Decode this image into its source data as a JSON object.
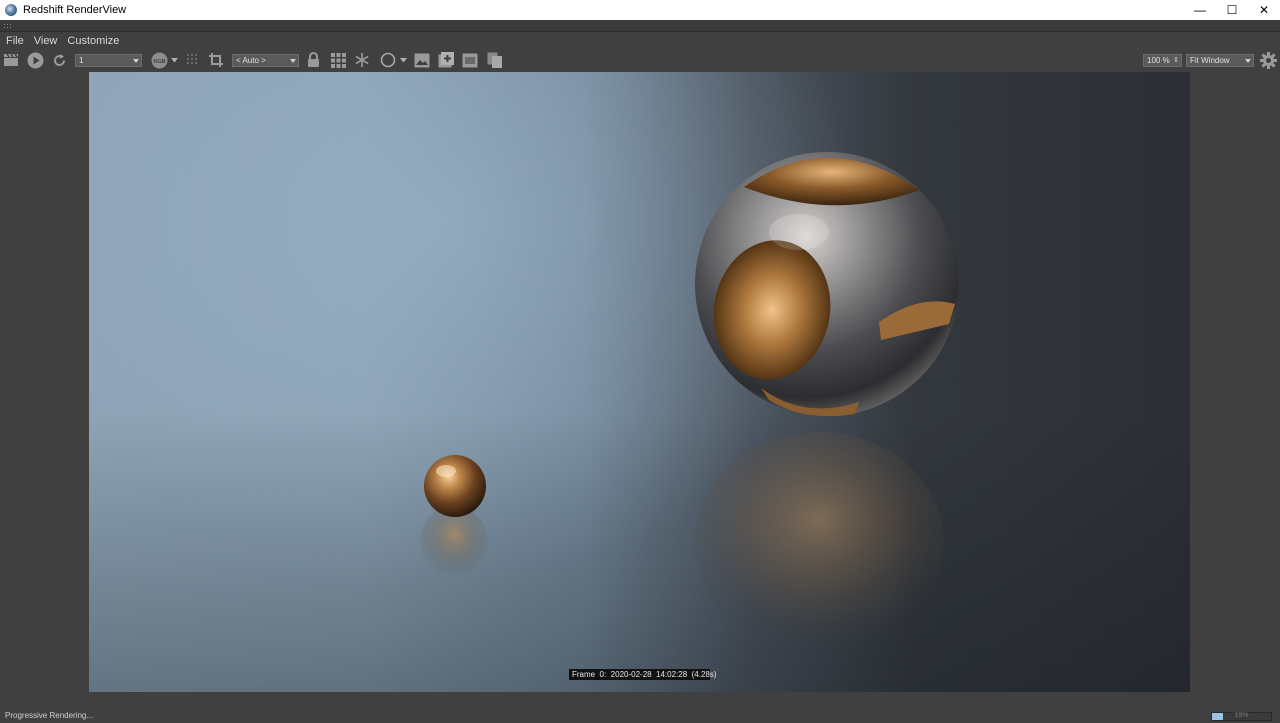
{
  "window": {
    "title": "Redshift RenderView",
    "minimize": "—",
    "maximize": "☐",
    "close": "✕"
  },
  "menu": {
    "items": [
      "File",
      "View",
      "Customize"
    ]
  },
  "toolbar": {
    "snapshot_select": "1",
    "rgb_label": "RGB",
    "aov_select": "< Auto >",
    "zoom_value": "100 %",
    "fit_select": "Fit Window"
  },
  "render": {
    "info_overlay": "Frame  0:  2020-02-28  14:02:28  (4.28s)"
  },
  "status": {
    "text": "Progressive Rendering...",
    "progress_label": "19%",
    "progress_value": 0.19
  },
  "colors": {
    "accent": "#9cc1e3",
    "background": "#404040",
    "copper": "#b07a3e"
  },
  "icons": [
    "clapper-icon",
    "play-icon",
    "refresh-icon",
    "rgb-icon",
    "grid-dots-icon",
    "crop-icon",
    "lock-icon",
    "grid-icon",
    "snowflake-icon",
    "circle-icon",
    "image-icon",
    "add-snapshot-icon",
    "compare-icon",
    "copy-icon",
    "gear-icon"
  ]
}
